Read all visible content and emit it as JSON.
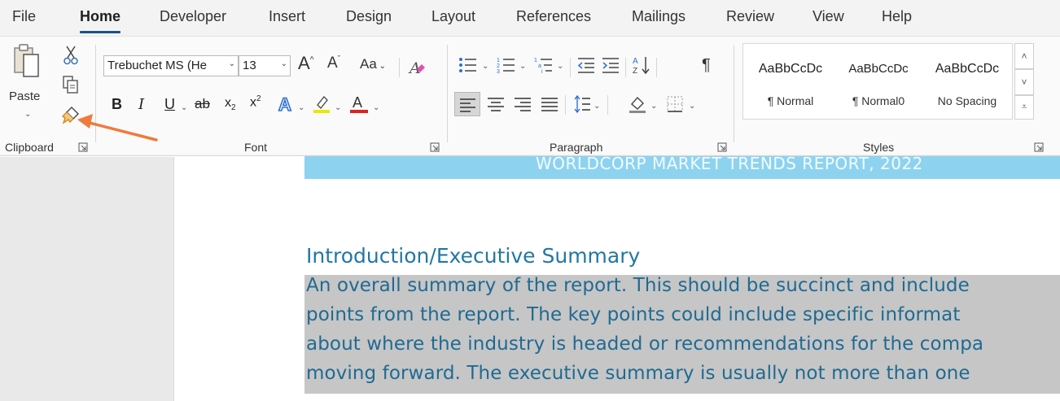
{
  "tabs": [
    {
      "label": "File"
    },
    {
      "label": "Home"
    },
    {
      "label": "Developer"
    },
    {
      "label": "Insert"
    },
    {
      "label": "Design"
    },
    {
      "label": "Layout"
    },
    {
      "label": "References"
    },
    {
      "label": "Mailings"
    },
    {
      "label": "Review"
    },
    {
      "label": "View"
    },
    {
      "label": "Help"
    }
  ],
  "clipboard": {
    "paste_label": "Paste",
    "group_label": "Clipboard"
  },
  "font": {
    "font_name": "Trebuchet MS (He",
    "font_size": "13",
    "change_case_label": "Aa",
    "group_label": "Font",
    "colors": {
      "highlight": "#e8e800",
      "font_color": "#e02020",
      "text_effects": "#2f6fd0"
    }
  },
  "paragraph": {
    "group_label": "Paragraph"
  },
  "styles": {
    "group_label": "Styles",
    "items": [
      {
        "sample": "AaBbCcDc",
        "name": "¶ Normal"
      },
      {
        "sample": "AaBbCcDc",
        "name": "¶ Normal0"
      },
      {
        "sample": "AaBbCcDc",
        "name": "No Spacing"
      }
    ]
  },
  "document": {
    "banner": "WORLDCORP MARKET TRENDS REPORT, 2022",
    "heading": "Introduction/Executive Summary",
    "lines": [
      "An overall summary of the report.  This should be succinct and include",
      "points from the report.  The key points could include specific informat",
      "about where the industry is headed or recommendations for the compa",
      "moving forward.  The executive summary is usually not more than one"
    ],
    "colors": {
      "banner": "#8dd3f0",
      "heading": "#2277a4",
      "body": "#1f6a93",
      "selection": "#c6c6c6"
    }
  },
  "annotation": {
    "arrow_color": "#f07a3c"
  }
}
